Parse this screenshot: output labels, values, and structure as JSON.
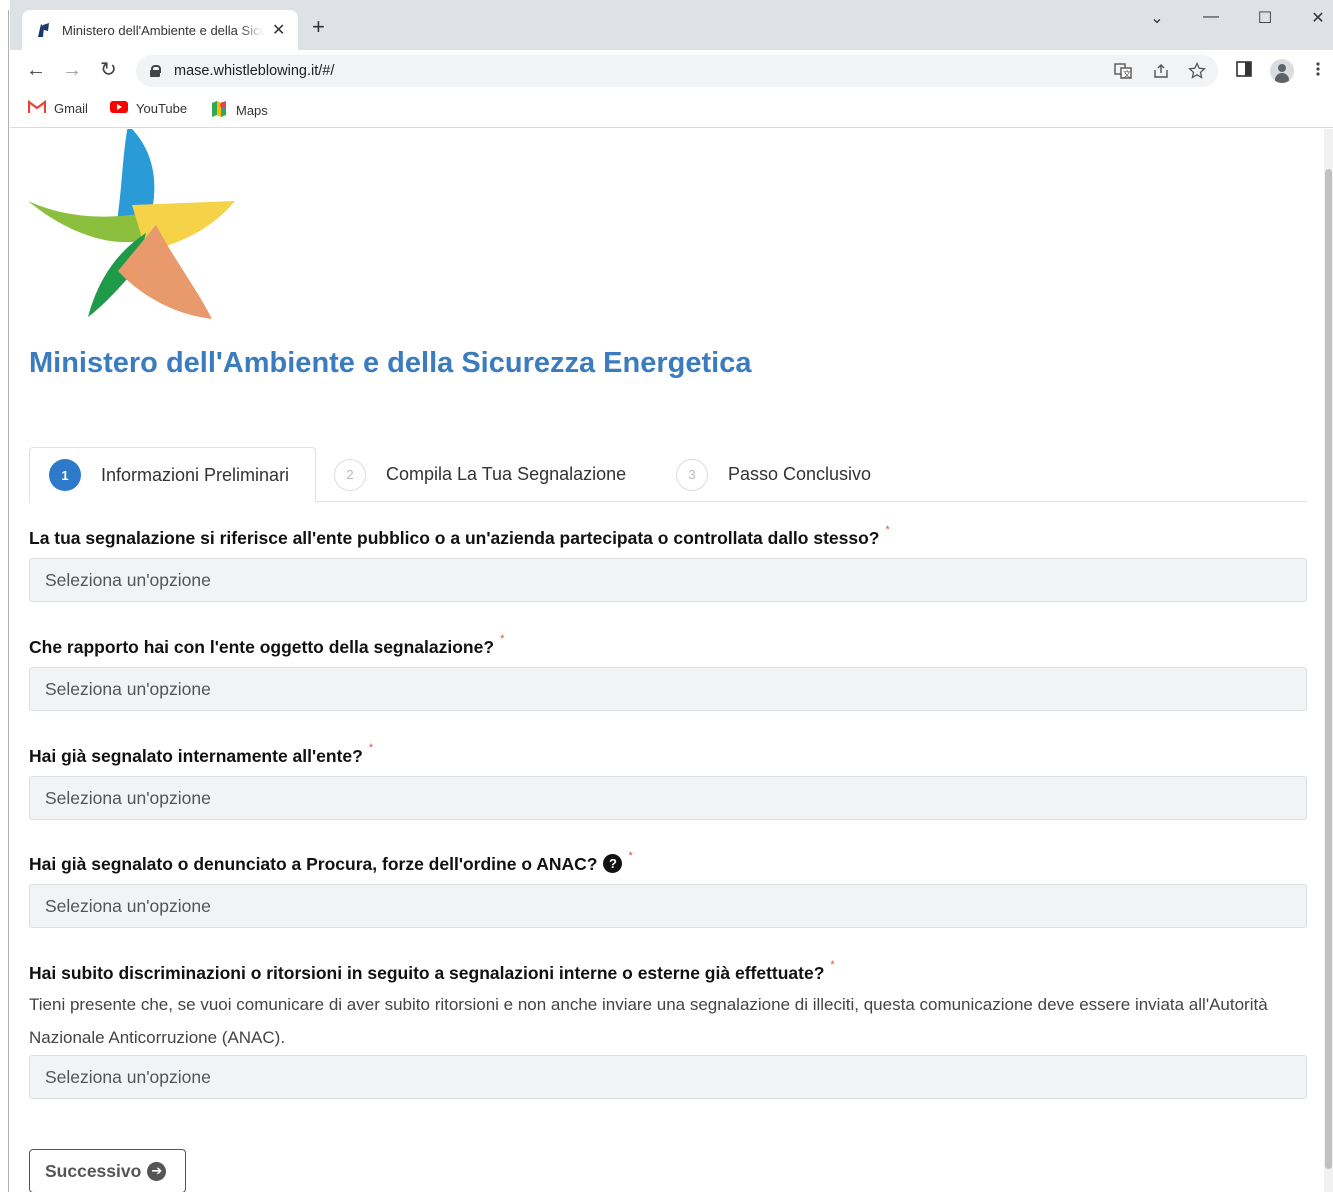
{
  "browser": {
    "tab_title": "Ministero dell'Ambiente e della Sicurezza Energetica",
    "tab_close": "✕",
    "new_tab": "+",
    "url": "mase.whistleblowing.it/#/",
    "window_controls": {
      "dropdown": "⌄",
      "minimize": "—",
      "maximize": "☐",
      "close": "✕"
    },
    "nav": {
      "back": "←",
      "forward": "→",
      "reload": "↻"
    },
    "bookmarks": [
      {
        "label": "Gmail",
        "icon": "gmail-icon"
      },
      {
        "label": "YouTube",
        "icon": "youtube-icon"
      },
      {
        "label": "Maps",
        "icon": "maps-icon"
      }
    ]
  },
  "page": {
    "ministry_title": "Ministero dell'Ambiente e della Sicurezza Energetica",
    "steps": [
      {
        "number": "1",
        "label": "Informazioni Preliminari",
        "active": true
      },
      {
        "number": "2",
        "label": "Compila La Tua Segnalazione",
        "active": false
      },
      {
        "number": "3",
        "label": "Passo Conclusivo",
        "active": false
      }
    ],
    "required_mark": "*",
    "questions": [
      {
        "label": "La tua segnalazione si riferisce all'ente pubblico o a un'azienda partecipata o controllata dallo stesso?",
        "placeholder": "Seleziona un'opzione"
      },
      {
        "label": "Che rapporto hai con l'ente oggetto della segnalazione?",
        "placeholder": "Seleziona un'opzione"
      },
      {
        "label": "Hai già segnalato internamente all'ente?",
        "placeholder": "Seleziona un'opzione"
      },
      {
        "label": "Hai già segnalato o denunciato a Procura, forze dell'ordine o ANAC?",
        "placeholder": "Seleziona un'opzione",
        "help": "?"
      },
      {
        "label": "Hai subito discriminazioni o ritorsioni in seguito a segnalazioni interne o esterne già effettuate?",
        "placeholder": "Seleziona un'opzione",
        "description": "Tieni presente che, se vuoi comunicare di aver subito ritorsioni e non anche inviare una segnalazione di illeciti, questa comunicazione deve essere inviata all'Autorità Nazionale Anticorruzione (ANAC)."
      }
    ],
    "next_button": "Successivo",
    "next_icon": "➔"
  },
  "colors": {
    "title_blue": "#3b7bbf",
    "step_active": "#2c7ac9",
    "required": "#d9534f"
  }
}
